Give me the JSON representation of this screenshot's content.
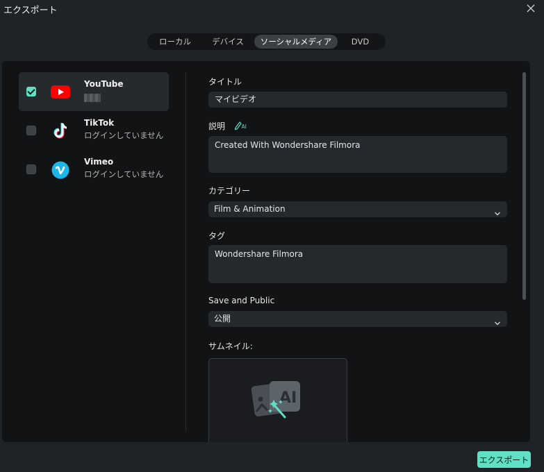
{
  "window": {
    "title": "エクスポート"
  },
  "tabs": [
    {
      "label": "ローカル",
      "active": false
    },
    {
      "label": "デバイス",
      "active": false
    },
    {
      "label": "ソーシャルメディア",
      "active": true
    },
    {
      "label": "DVD",
      "active": false
    }
  ],
  "accounts": [
    {
      "name": "YouTube",
      "status": "",
      "checked": true,
      "icon": "youtube-icon"
    },
    {
      "name": "TikTok",
      "status": "ログインしていません",
      "checked": false,
      "icon": "tiktok-icon"
    },
    {
      "name": "Vimeo",
      "status": "ログインしていません",
      "checked": false,
      "icon": "vimeo-icon"
    }
  ],
  "form": {
    "title_label": "タイトル",
    "title_value": "マイビデオ",
    "description_label": "説明",
    "description_ai_icon": "ai-pen-icon",
    "description_value": "Created With Wondershare Filmora",
    "category_label": "カテゴリー",
    "category_value": "Film & Animation",
    "tag_label": "タグ",
    "tag_value": "Wondershare Filmora",
    "privacy_label": "Save and Public",
    "privacy_value": "公開",
    "thumbnail_label": "サムネイル:"
  },
  "export_button": "エクスポート",
  "colors": {
    "accent": "#5fe0c4",
    "background": "#1f2226",
    "panel": "#111315"
  }
}
